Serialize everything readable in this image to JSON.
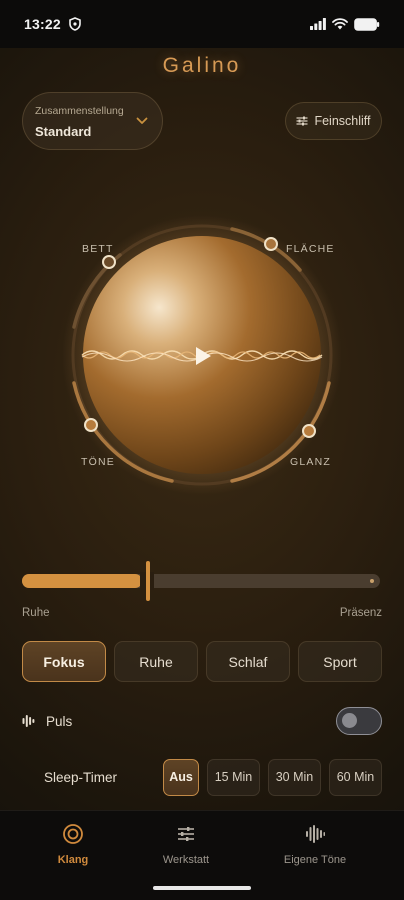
{
  "status": {
    "time": "13:22"
  },
  "app": {
    "title": "Galino"
  },
  "preset": {
    "label": "Zusammenstellung",
    "value": "Standard"
  },
  "fine_tune": {
    "label": "Feinschliff"
  },
  "orb": {
    "labels": {
      "top_left": "BETT",
      "top_right": "FLÄCHE",
      "bottom_left": "TÖNE",
      "bottom_right": "GLANZ"
    },
    "accent": "#c88a45"
  },
  "slider": {
    "left_label": "Ruhe",
    "right_label": "Präsenz",
    "value": 0.35
  },
  "modes": {
    "items": [
      "Fokus",
      "Ruhe",
      "Schlaf",
      "Sport"
    ],
    "selected": "Fokus"
  },
  "puls": {
    "label": "Puls",
    "enabled": false
  },
  "sleep_timer": {
    "label": "Sleep-Timer",
    "options": [
      "Aus",
      "15 Min",
      "30 Min",
      "60 Min"
    ],
    "selected": "Aus"
  },
  "nav": {
    "items": [
      {
        "label": "Klang",
        "icon": "target-icon"
      },
      {
        "label": "Werkstatt",
        "icon": "sliders-icon"
      },
      {
        "label": "Eigene Töne",
        "icon": "waveform-icon"
      }
    ],
    "active": "Klang"
  }
}
